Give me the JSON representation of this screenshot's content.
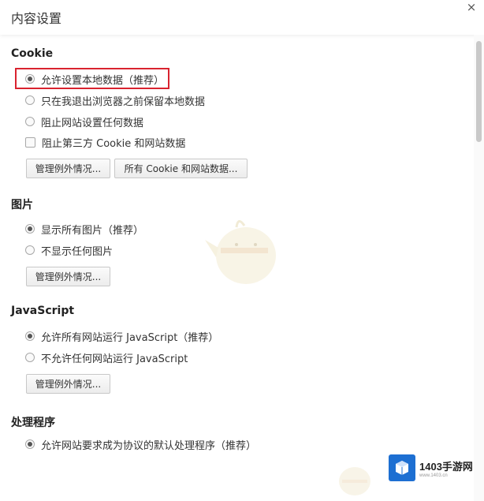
{
  "dialog": {
    "title": "内容设置",
    "close_symbol": "×"
  },
  "sections": {
    "cookie": {
      "heading": "Cookie",
      "options": [
        {
          "label": "允许设置本地数据（推荐）",
          "checked": true,
          "type": "radio"
        },
        {
          "label": "只在我退出浏览器之前保留本地数据",
          "checked": false,
          "type": "radio"
        },
        {
          "label": "阻止网站设置任何数据",
          "checked": false,
          "type": "radio"
        },
        {
          "label": "阻止第三方 Cookie 和网站数据",
          "checked": false,
          "type": "checkbox"
        }
      ],
      "buttons": [
        "管理例外情况...",
        "所有 Cookie 和网站数据..."
      ]
    },
    "images": {
      "heading": "图片",
      "options": [
        {
          "label": "显示所有图片（推荐）",
          "checked": true
        },
        {
          "label": "不显示任何图片",
          "checked": false
        }
      ],
      "button": "管理例外情况..."
    },
    "javascript": {
      "heading": "JavaScript",
      "options": [
        {
          "label": "允许所有网站运行 JavaScript（推荐）",
          "checked": true
        },
        {
          "label": "不允许任何网站运行 JavaScript",
          "checked": false
        }
      ],
      "button": "管理例外情况..."
    },
    "handlers": {
      "heading": "处理程序",
      "options": [
        {
          "label": "允许网站要求成为协议的默认处理程序（推荐）",
          "checked": true
        }
      ]
    }
  },
  "logo": {
    "name": "1403手游网",
    "url": "www.1403.cn"
  },
  "colors": {
    "highlight": "#d9232f",
    "logo": "#1d6fd2"
  }
}
